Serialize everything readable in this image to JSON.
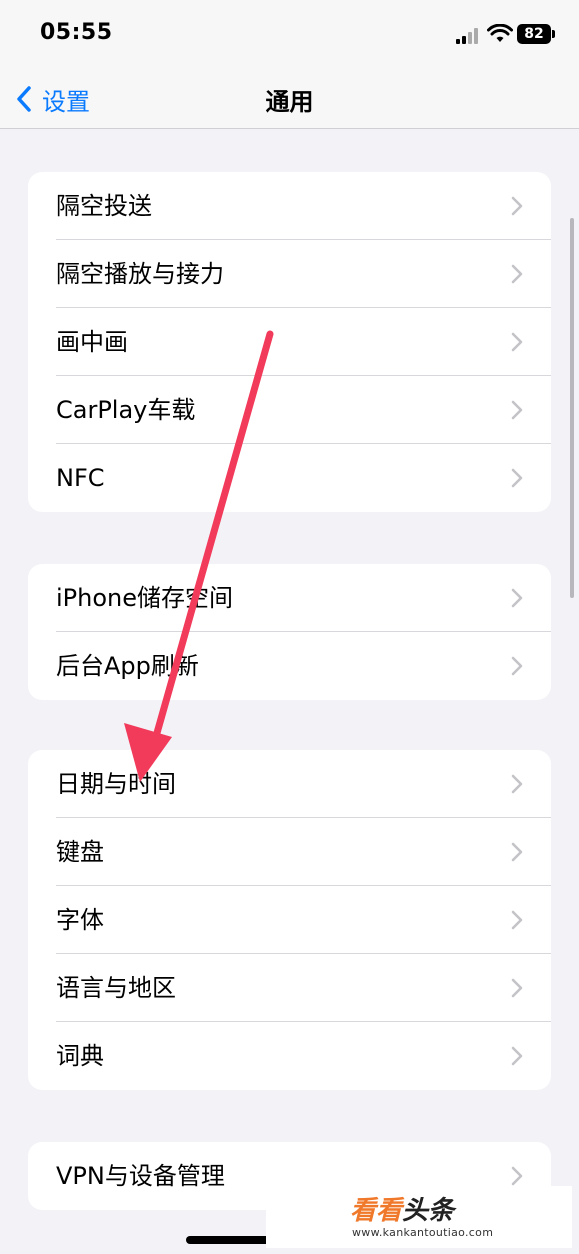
{
  "status_bar": {
    "time": "05:55",
    "battery": "82"
  },
  "nav": {
    "back_label": "设置",
    "title": "通用"
  },
  "groups": [
    {
      "rows": [
        {
          "label": "隔空投送"
        },
        {
          "label": "隔空播放与接力"
        },
        {
          "label": "画中画"
        },
        {
          "label": "CarPlay车载"
        },
        {
          "label": "NFC"
        }
      ]
    },
    {
      "rows": [
        {
          "label": "iPhone储存空间"
        },
        {
          "label": "后台App刷新"
        }
      ]
    },
    {
      "rows": [
        {
          "label": "日期与时间"
        },
        {
          "label": "键盘"
        },
        {
          "label": "字体"
        },
        {
          "label": "语言与地区"
        },
        {
          "label": "词典"
        }
      ]
    },
    {
      "rows": [
        {
          "label": "VPN与设备管理"
        }
      ]
    }
  ],
  "annotation": {
    "color": "#f23a5a"
  },
  "watermark": {
    "part1": "看看",
    "part2": "头条",
    "url": "www.kankantoutiao.com"
  },
  "colors": {
    "accent": "#0a7aff",
    "background": "#f2f2f7",
    "chevron": "#c4c4c8"
  }
}
